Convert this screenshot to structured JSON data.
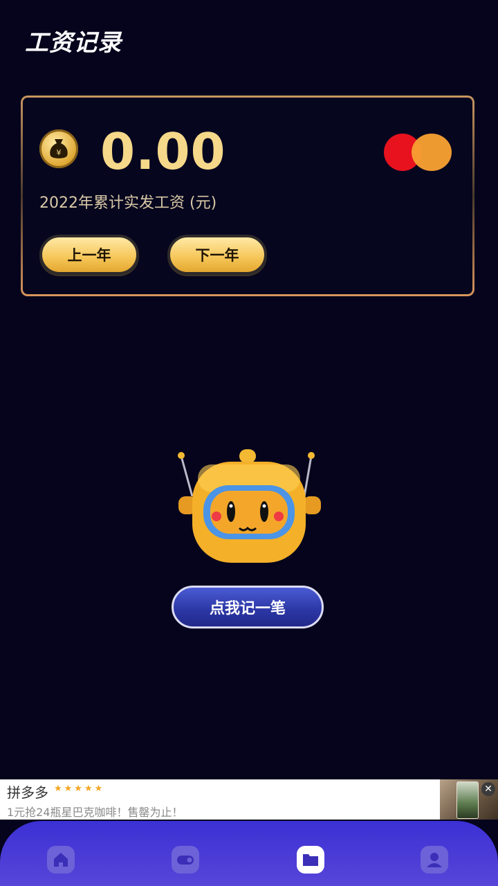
{
  "header": {
    "title": "工资记录"
  },
  "summary": {
    "amount": "0.00",
    "subtitle": "2022年累计实发工资 (元)",
    "prev_year_label": "上一年",
    "next_year_label": "下一年",
    "icon": "money-bag-icon"
  },
  "main": {
    "record_button_label": "点我记一笔",
    "mascot": "robot-mascot"
  },
  "ad": {
    "title": "拼多多",
    "stars": "★★★★★",
    "description": "1元抢24瓶星巴克咖啡！售罄为止！",
    "close_label": "✕"
  },
  "tabbar": {
    "items": [
      {
        "name": "home",
        "icon": "home-icon",
        "active": false
      },
      {
        "name": "wallet",
        "icon": "wallet-icon",
        "active": false
      },
      {
        "name": "records",
        "icon": "folder-icon",
        "active": true
      },
      {
        "name": "profile",
        "icon": "user-icon",
        "active": false
      }
    ]
  },
  "colors": {
    "background": "#05041c",
    "accent_gold": "#f5d889",
    "button_blue": "#2b36a4",
    "tabbar": "#4a3ad6"
  }
}
